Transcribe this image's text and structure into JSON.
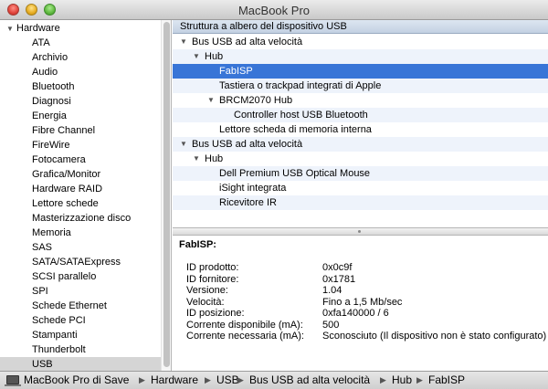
{
  "window": {
    "title": "MacBook Pro"
  },
  "sidebar": {
    "root_label": "Hardware",
    "items": [
      "ATA",
      "Archivio",
      "Audio",
      "Bluetooth",
      "Diagnosi",
      "Energia",
      "Fibre Channel",
      "FireWire",
      "Fotocamera",
      "Grafica/Monitor",
      "Hardware RAID",
      "Lettore schede",
      "Masterizzazione disco",
      "Memoria",
      "SAS",
      "SATA/SATAExpress",
      "SCSI parallelo",
      "SPI",
      "Schede Ethernet",
      "Schede PCI",
      "Stampanti",
      "Thunderbolt",
      "USB"
    ],
    "selected": "USB"
  },
  "tree": {
    "header": "Struttura a albero del dispositivo USB",
    "rows": [
      {
        "label": "Bus USB ad alta velocità",
        "level": 0,
        "expanded": true
      },
      {
        "label": "Hub",
        "level": 1,
        "expanded": true
      },
      {
        "label": "FabISP",
        "level": 2,
        "selected": true
      },
      {
        "label": "Tastiera o trackpad integrati di Apple",
        "level": 2
      },
      {
        "label": "BRCM2070 Hub",
        "level": 2,
        "expanded": true
      },
      {
        "label": "Controller host USB Bluetooth",
        "level": 3
      },
      {
        "label": "Lettore scheda di memoria interna",
        "level": 2
      },
      {
        "label": "Bus USB ad alta velocità",
        "level": 0,
        "expanded": true
      },
      {
        "label": "Hub",
        "level": 1,
        "expanded": true
      },
      {
        "label": "Dell Premium USB Optical Mouse",
        "level": 2
      },
      {
        "label": "iSight integrata",
        "level": 2
      },
      {
        "label": "Ricevitore IR",
        "level": 2
      }
    ]
  },
  "details": {
    "title": "FabISP:",
    "rows": [
      {
        "key": "ID prodotto:",
        "value": "0x0c9f"
      },
      {
        "key": "ID fornitore:",
        "value": "0x1781"
      },
      {
        "key": "Versione:",
        "value": " 1.04"
      },
      {
        "key": "Velocità:",
        "value": "Fino a 1,5 Mb/sec"
      },
      {
        "key": "ID posizione:",
        "value": "0xfa140000 / 6"
      },
      {
        "key": "Corrente disponibile (mA):",
        "value": "500"
      },
      {
        "key": "Corrente necessaria (mA):",
        "value": "Sconosciuto (Il dispositivo non è stato configurato)"
      }
    ]
  },
  "pathbar": {
    "segments": [
      "MacBook Pro di Save",
      "Hardware",
      "USB",
      "Bus USB ad alta velocità",
      "Hub",
      "FabISP"
    ]
  },
  "colors": {
    "selection": "#3875d7",
    "sidebar_selection": "#d5d5d5",
    "header_bg": "#c3d1e3"
  }
}
